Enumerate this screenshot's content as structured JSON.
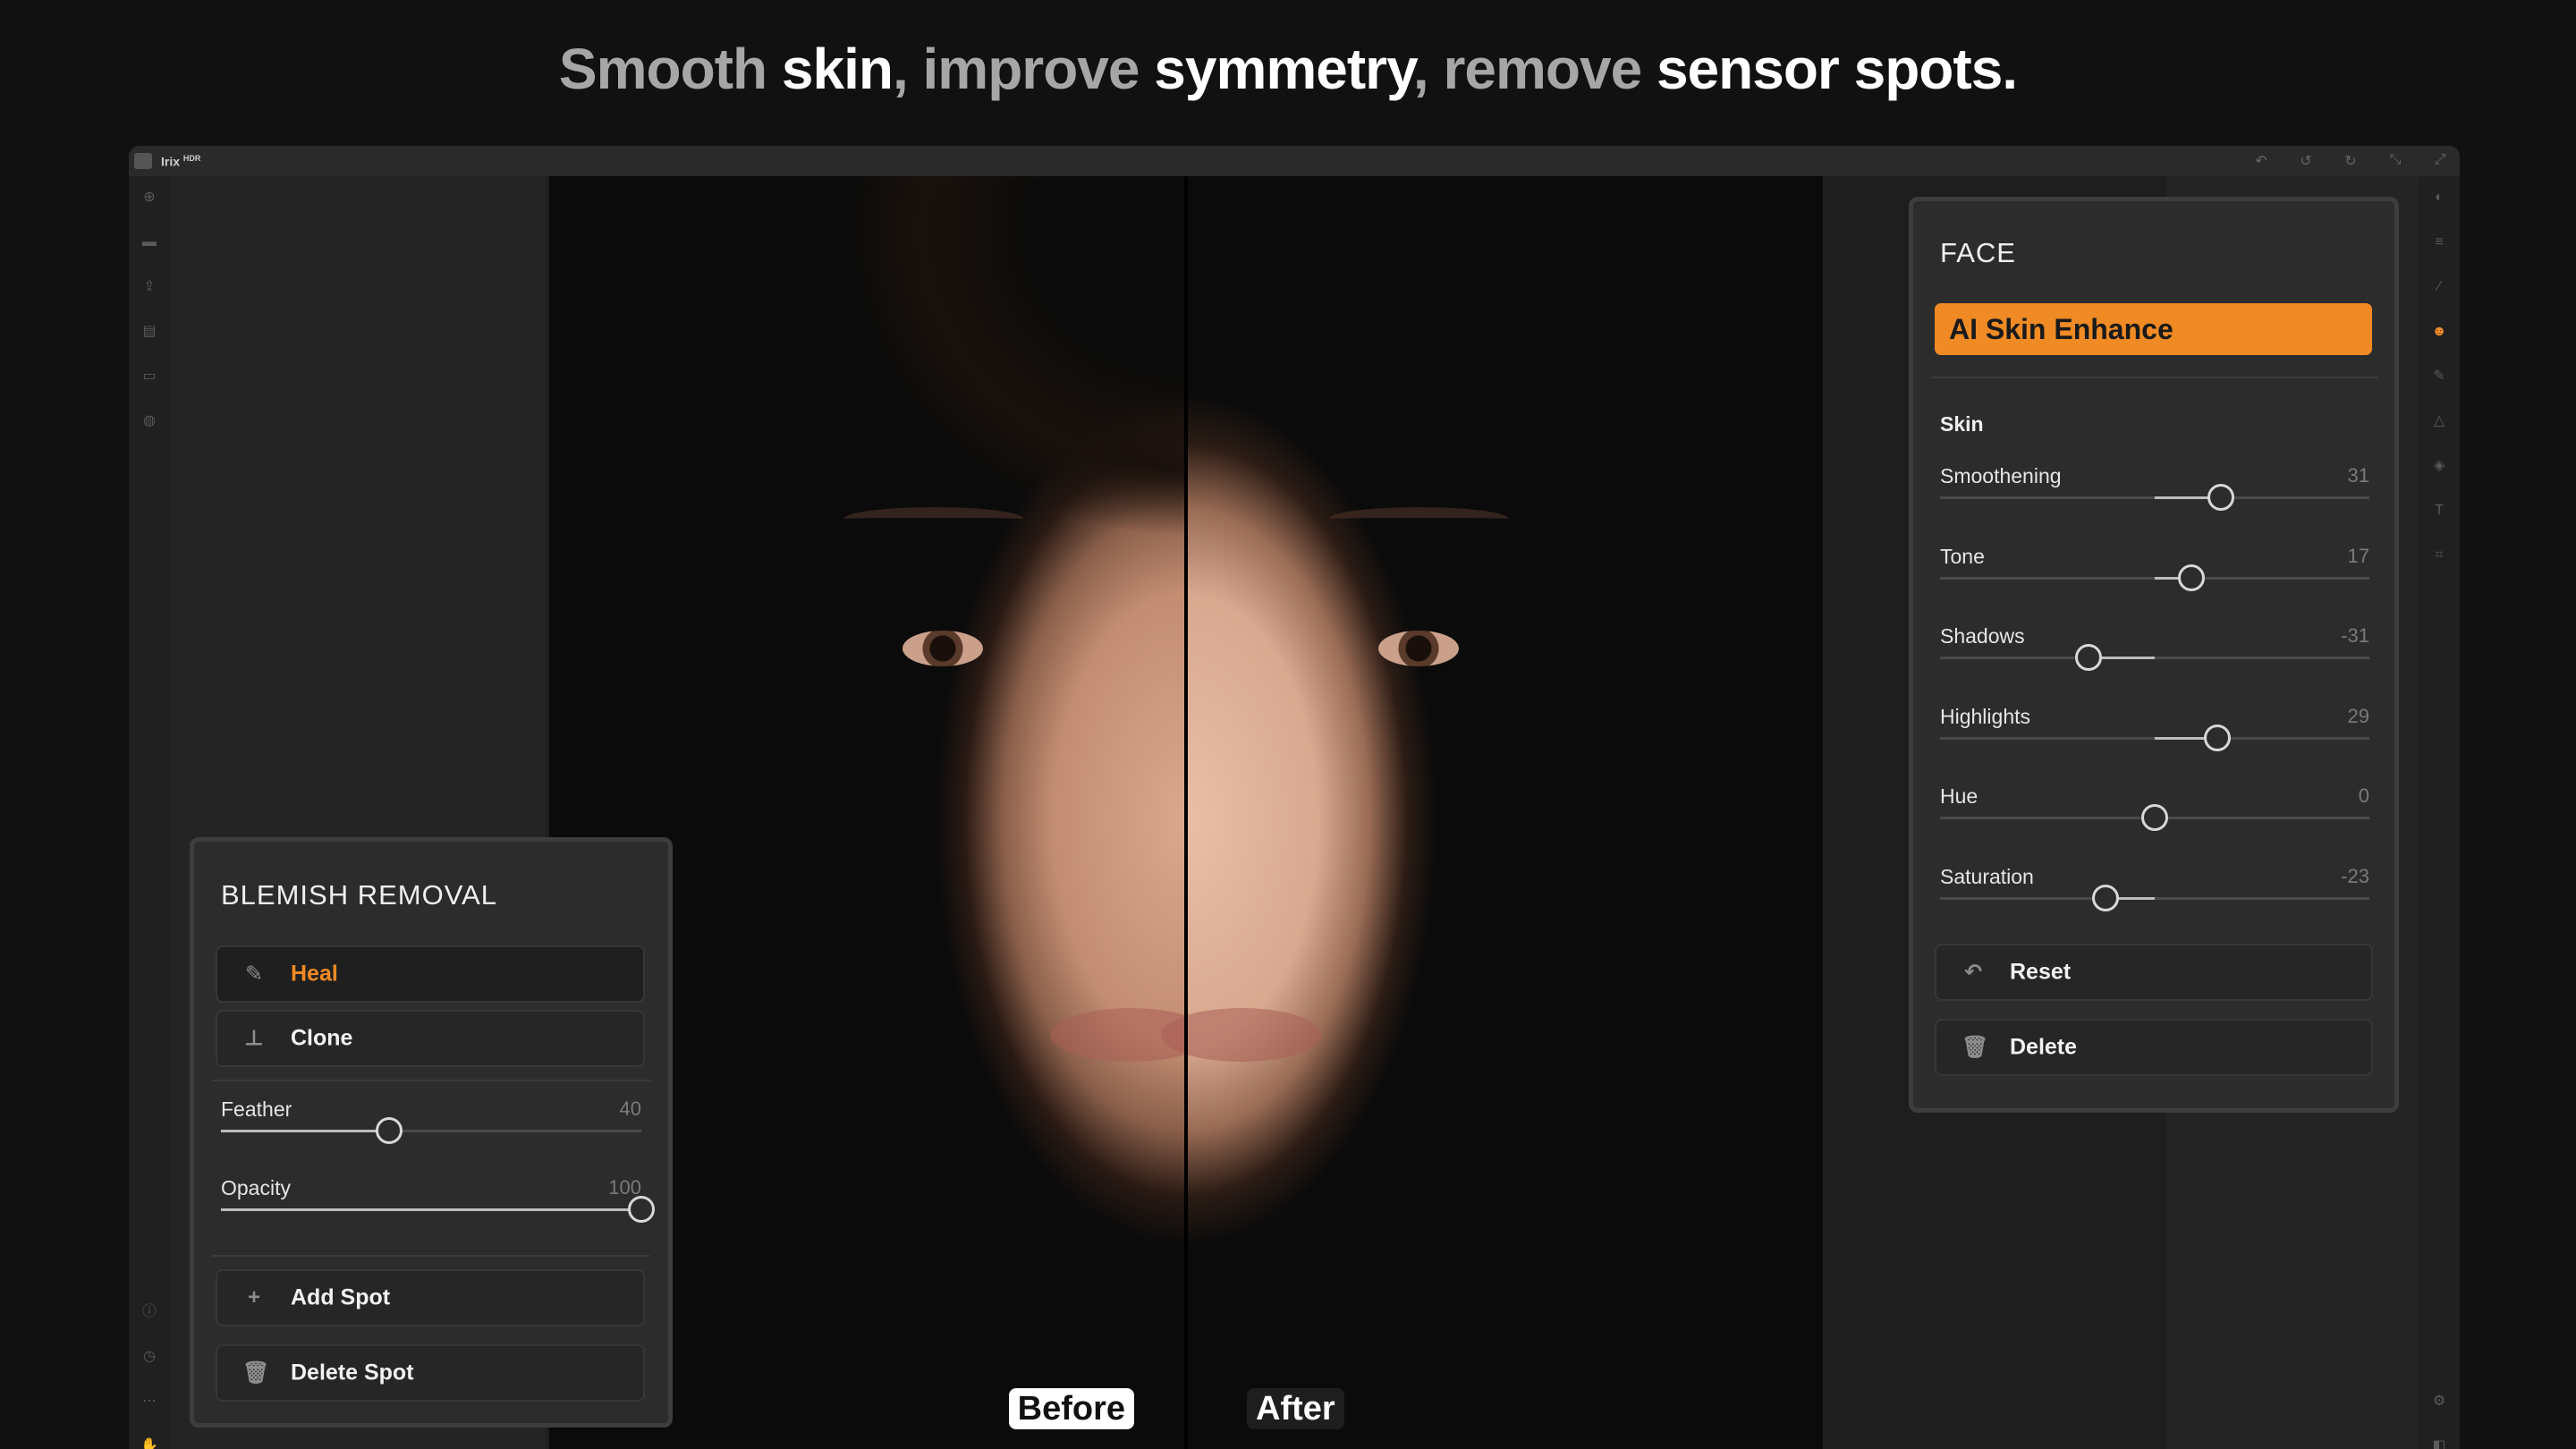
{
  "headline": [
    {
      "text": "Smooth ",
      "style": "dim"
    },
    {
      "text": "skin",
      "style": "bright"
    },
    {
      "text": ", improve ",
      "style": "dim"
    },
    {
      "text": "symmetry",
      "style": "bright"
    },
    {
      "text": ", remove ",
      "style": "dim"
    },
    {
      "text": "sensor spots.",
      "style": "bright"
    }
  ],
  "app": {
    "name": "Irix",
    "badge": "HDR"
  },
  "photo": {
    "before_label": "Before",
    "after_label": "After"
  },
  "blemish": {
    "title": "BLEMISH REMOVAL",
    "tools": [
      {
        "label": "Heal",
        "icon": "bandage-icon",
        "active": true
      },
      {
        "label": "Clone",
        "icon": "stamp-icon",
        "active": false
      }
    ],
    "sliders": [
      {
        "label": "Feather",
        "value": 40,
        "min": 0,
        "max": 100
      },
      {
        "label": "Opacity",
        "value": 100,
        "min": 0,
        "max": 100
      }
    ],
    "add_label": "Add Spot",
    "delete_label": "Delete Spot"
  },
  "face": {
    "title": "FACE",
    "ai_label": "AI Skin Enhance",
    "section": "Skin",
    "sliders": [
      {
        "label": "Smoothening",
        "value": 31,
        "min": -100,
        "max": 100
      },
      {
        "label": "Tone",
        "value": 17,
        "min": -100,
        "max": 100
      },
      {
        "label": "Shadows",
        "value": -31,
        "min": -100,
        "max": 100
      },
      {
        "label": "Highlights",
        "value": 29,
        "min": -100,
        "max": 100
      },
      {
        "label": "Hue",
        "value": 0,
        "min": -100,
        "max": 100
      },
      {
        "label": "Saturation",
        "value": -23,
        "min": -100,
        "max": 100
      }
    ],
    "reset_label": "Reset",
    "delete_label": "Delete"
  },
  "colors": {
    "accent": "#f08a24"
  }
}
